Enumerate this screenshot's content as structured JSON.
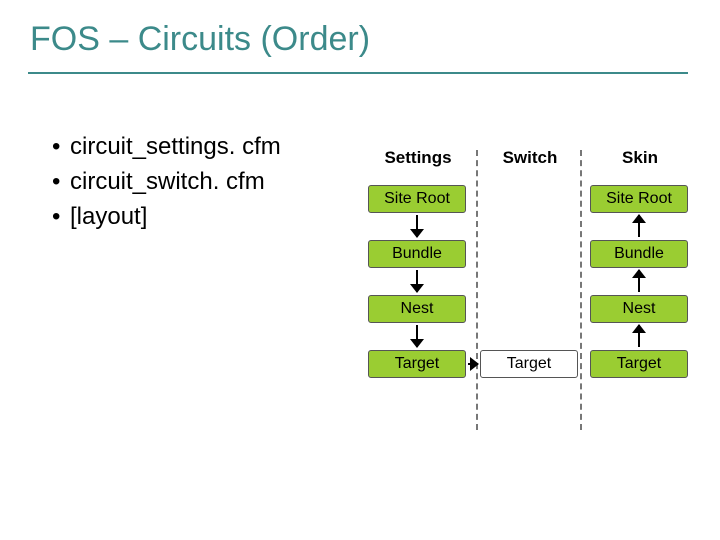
{
  "title": "FOS – Circuits (Order)",
  "bullets": [
    "circuit_settings. cfm",
    "circuit_switch. cfm",
    "[layout]"
  ],
  "columns": {
    "settings": {
      "header": "Settings",
      "boxes": [
        "Site Root",
        "Bundle",
        "Nest",
        "Target"
      ]
    },
    "switch": {
      "header": "Switch",
      "boxes": [
        "Target"
      ]
    },
    "skin": {
      "header": "Skin",
      "boxes": [
        "Site Root",
        "Bundle",
        "Nest",
        "Target"
      ]
    }
  }
}
